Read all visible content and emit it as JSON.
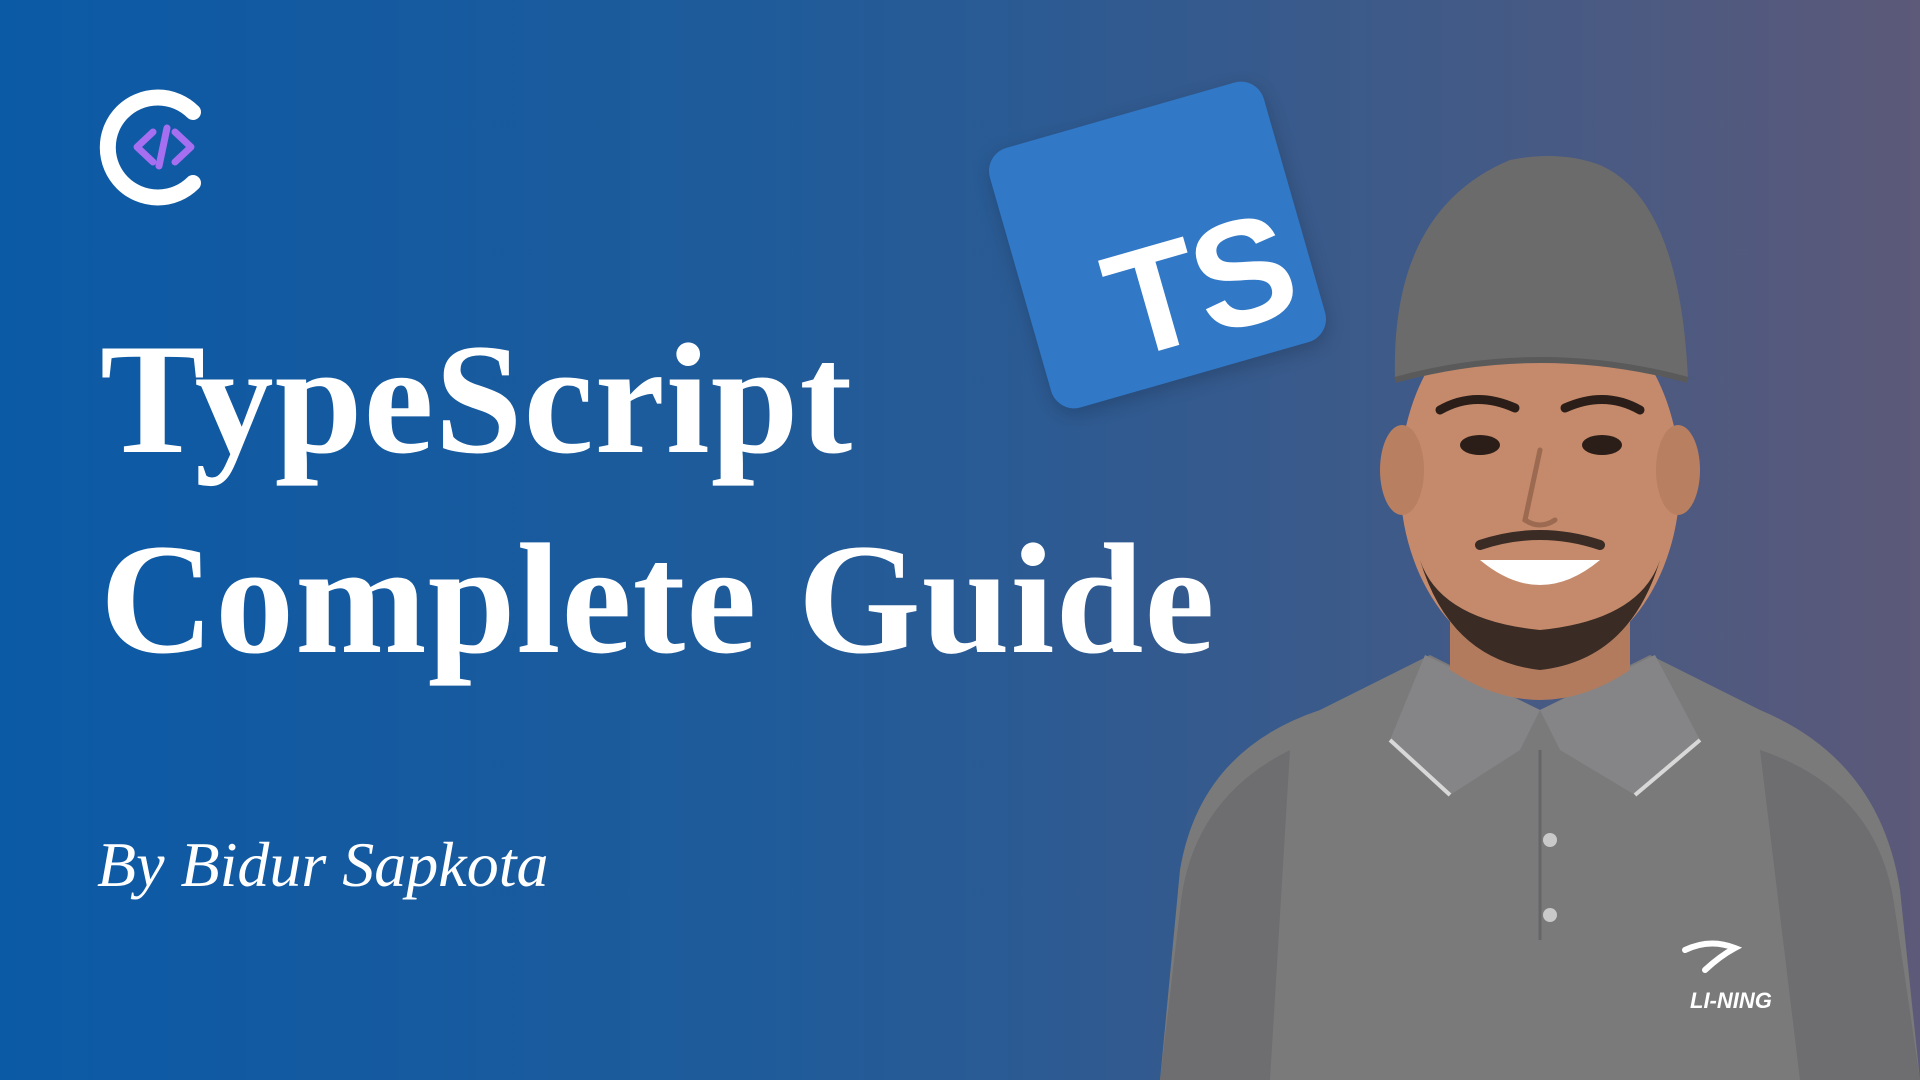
{
  "thumbnail": {
    "title_line_1": "TypeScript",
    "title_line_2": "Complete Guide",
    "byline": "By Bidur Sapkota",
    "badge_text": "TS",
    "shirt_logo_text": "LI-NING"
  },
  "colors": {
    "background_left": "#0b5aa6",
    "background_right": "#5c5979",
    "ts_blue": "#3178c6",
    "logo_purple": "#a66ef0",
    "text": "#ffffff"
  },
  "icons": {
    "logo": "c-code-logo-icon",
    "badge": "typescript-badge-icon"
  }
}
